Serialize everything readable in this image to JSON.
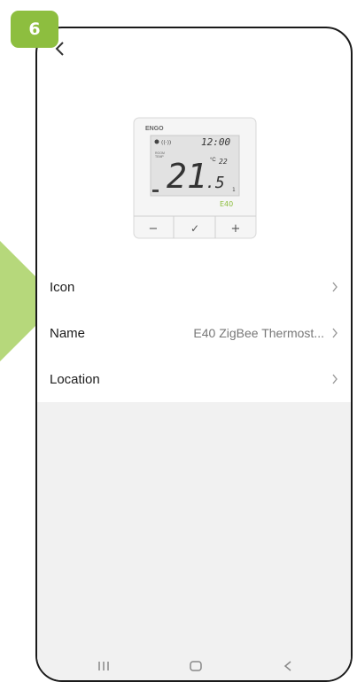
{
  "step": {
    "number": "6",
    "color": "#8dbe3f"
  },
  "header": {
    "back_icon": "chevron-left-icon"
  },
  "device": {
    "brand": "ENGO",
    "model": "E40",
    "time": "12:00",
    "temp_main": "21",
    "temp_decimal": ".5",
    "unit": "°C",
    "set_temp": "22",
    "buttons": [
      "−",
      "✓",
      "+"
    ]
  },
  "settings": {
    "items": [
      {
        "label": "Icon",
        "value": ""
      },
      {
        "label": "Name",
        "value": "E40 ZigBee Thermost..."
      },
      {
        "label": "Location",
        "value": ""
      }
    ]
  },
  "nav": {
    "icons": [
      "recents-icon",
      "home-icon",
      "back-icon"
    ]
  }
}
